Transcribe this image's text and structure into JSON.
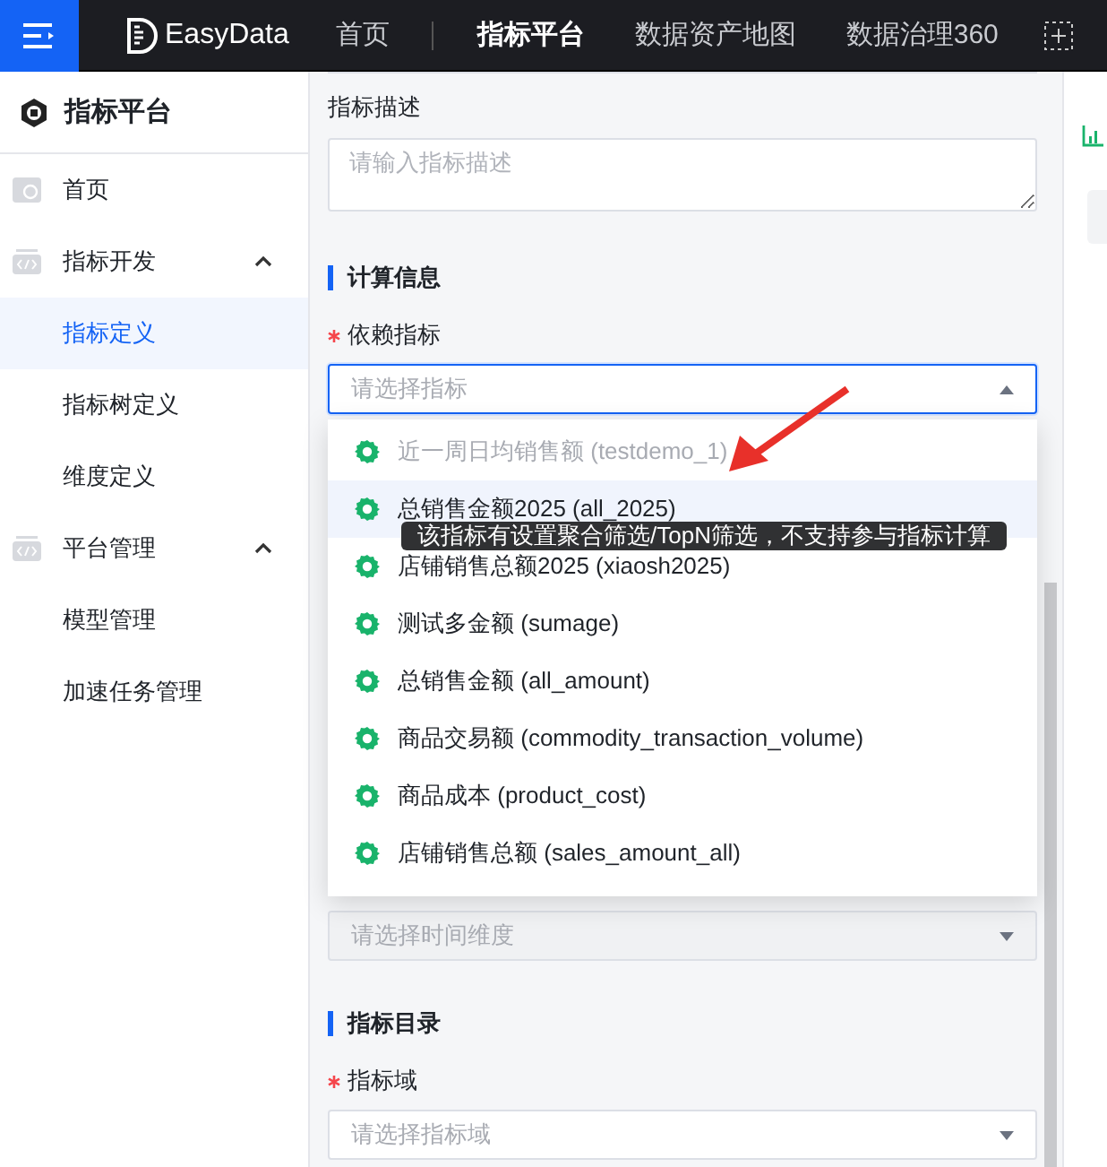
{
  "header": {
    "brand": "EasyData",
    "nav": [
      {
        "label": "首页",
        "selected": false
      },
      {
        "label": "指标平台",
        "selected": true
      },
      {
        "label": "数据资产地图",
        "selected": false
      },
      {
        "label": "数据治理360",
        "selected": false
      }
    ]
  },
  "sidebar": {
    "title": "指标平台",
    "items": [
      {
        "label": "首页"
      },
      {
        "label": "指标开发",
        "expanded": true,
        "children": [
          {
            "label": "指标定义",
            "selected": true
          },
          {
            "label": "指标树定义",
            "selected": false
          },
          {
            "label": "维度定义",
            "selected": false
          }
        ]
      },
      {
        "label": "平台管理",
        "expanded": true,
        "children": [
          {
            "label": "模型管理",
            "selected": false
          },
          {
            "label": "加速任务管理",
            "selected": false
          }
        ]
      }
    ]
  },
  "form": {
    "description": {
      "label": "指标描述",
      "placeholder": "请输入指标描述"
    },
    "calc_section": {
      "title": "计算信息"
    },
    "depend": {
      "label": "依赖指标",
      "required": true,
      "placeholder": "请选择指标",
      "open": true,
      "options": [
        {
          "label": "近一周日均销售额 (testdemo_1)",
          "disabled": true,
          "hovered": false
        },
        {
          "label": "总销售金额2025 (all_2025)",
          "disabled": false,
          "hovered": true,
          "tooltip": "该指标有设置聚合筛选/TopN筛选，不支持参与指标计算"
        },
        {
          "label": "店铺销售总额2025 (xiaosh2025)",
          "disabled": false,
          "hovered": false
        },
        {
          "label": "测试多金额 (sumage)",
          "disabled": false,
          "hovered": false
        },
        {
          "label": "总销售金额 (all_amount)",
          "disabled": false,
          "hovered": false
        },
        {
          "label": "商品交易额 (commodity_transaction_volume)",
          "disabled": false,
          "hovered": false
        },
        {
          "label": "商品成本 (product_cost)",
          "disabled": false,
          "hovered": false
        },
        {
          "label": "店铺销售总额 (sales_amount_all)",
          "disabled": false,
          "hovered": false
        }
      ]
    },
    "time_dimension": {
      "placeholder": "请选择时间维度",
      "open": false
    },
    "catalog_section": {
      "title": "指标目录"
    },
    "domain": {
      "label": "指标域",
      "required": true,
      "placeholder": "请选择指标域",
      "open": false
    }
  }
}
